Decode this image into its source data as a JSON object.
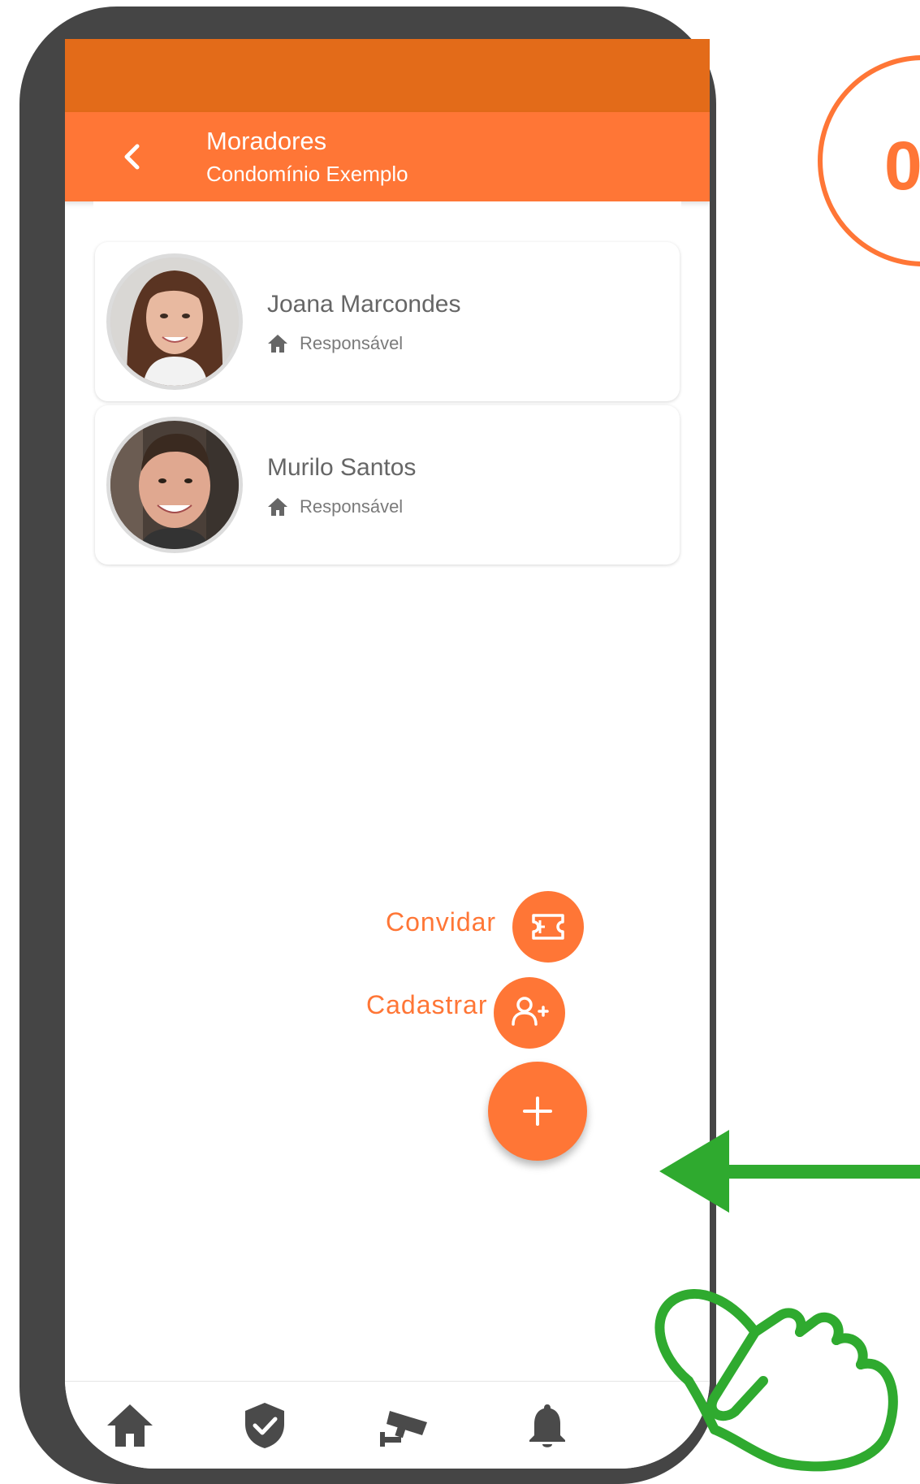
{
  "header": {
    "title": "Moradores",
    "subtitle": "Condomínio Exemplo"
  },
  "residents": [
    {
      "name": "Joana Marcondes",
      "role": "Responsável"
    },
    {
      "name": "Murilo Santos",
      "role": "Responsável"
    }
  ],
  "speed_dial": {
    "invite_label": "Convidar",
    "register_label": "Cadastrar"
  },
  "annotation": {
    "step_number": "0"
  },
  "colors": {
    "accent": "#ff7636",
    "status_bar": "#e36b19",
    "frame": "#454545",
    "pointer_green": "#2faa2f"
  },
  "icons": {
    "back": "chevron-left-icon",
    "role": "home-icon",
    "invite": "ticket-icon",
    "register": "add-person-icon",
    "fab": "plus-icon",
    "nav": [
      "home-icon",
      "shield-check-icon",
      "security-camera-icon",
      "bell-icon"
    ]
  }
}
